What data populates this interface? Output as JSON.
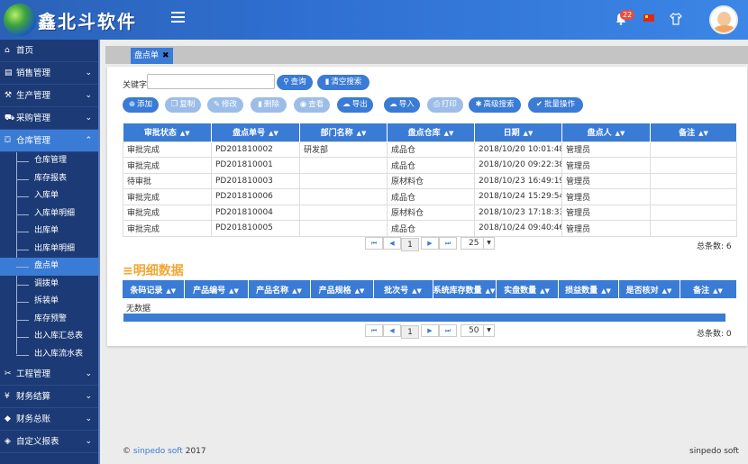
{
  "header": {
    "brand": "鑫北斗软件",
    "notification_count": "22",
    "colors": {
      "accent": "#3a7bd5",
      "sidebar": "#1c3b76",
      "section_title": "#f2a632"
    }
  },
  "sidebar": {
    "items": [
      {
        "label": "首页",
        "icon": "home-icon"
      },
      {
        "label": "销售管理",
        "icon": "list-icon"
      },
      {
        "label": "生产管理",
        "icon": "wrench-icon"
      },
      {
        "label": "采购管理",
        "icon": "cart-icon"
      },
      {
        "label": "仓库管理",
        "icon": "bag-icon"
      }
    ],
    "sub_items": [
      "仓库管理",
      "库存报表",
      "入库单",
      "入库单明细",
      "出库单",
      "出库单明细",
      "盘点单",
      "调拨单",
      "拆装单",
      "库存预警",
      "出入库汇总表",
      "出入库流水表"
    ],
    "bottom_items": [
      {
        "label": "工程管理",
        "icon": "tools-icon"
      },
      {
        "label": "财务结算",
        "icon": "money-icon"
      },
      {
        "label": "财务总账",
        "icon": "ledger-icon"
      },
      {
        "label": "自定义报表",
        "icon": "report-icon"
      }
    ]
  },
  "tabs": [
    {
      "label": "盘点单",
      "close": "✖"
    }
  ],
  "search": {
    "label": "关键字",
    "value": "",
    "query_button": "查询",
    "clear_button": "清空搜索"
  },
  "toolbar": {
    "add": "添加",
    "copy": "复制",
    "edit": "修改",
    "delete": "删除",
    "view": "查看",
    "export": "导出",
    "import": "导入",
    "print": "打印",
    "advanced": "高级搜索",
    "batch": "批量操作"
  },
  "main_table": {
    "headers": [
      "审批状态",
      "盘点单号",
      "部门名称",
      "盘点仓库",
      "日期",
      "盘点人",
      "备注"
    ],
    "rows": [
      [
        "审批完成",
        "PD201810002",
        "研发部",
        "成品仓",
        "2018/10/20 10:01:48",
        "管理员",
        ""
      ],
      [
        "审批完成",
        "PD201810001",
        "",
        "成品仓",
        "2018/10/20 09:22:38",
        "管理员",
        ""
      ],
      [
        "待审批",
        "PD201810003",
        "",
        "原材料仓",
        "2018/10/23 16:49:19",
        "管理员",
        ""
      ],
      [
        "审批完成",
        "PD201810006",
        "",
        "成品仓",
        "2018/10/24 15:29:54",
        "管理员",
        ""
      ],
      [
        "审批完成",
        "PD201810004",
        "",
        "原材料仓",
        "2018/10/23 17:18:33",
        "管理员",
        ""
      ],
      [
        "审批完成",
        "PD201810005",
        "",
        "成品仓",
        "2018/10/24 09:40:46",
        "管理员",
        ""
      ]
    ],
    "page": "1",
    "page_size": "25",
    "total": "总条数: 6"
  },
  "detail": {
    "title": "≡明细数据",
    "headers": [
      "条码记录",
      "产品编号",
      "产品名称",
      "产品规格",
      "批次号",
      "系统库存数量",
      "实盘数量",
      "损益数量",
      "是否核对",
      "备注"
    ],
    "empty": "无数据",
    "page": "1",
    "page_size": "50",
    "total": "总条数: 0"
  },
  "footer": {
    "copyright": "©",
    "brand": "sinpedo soft",
    "year": "2017",
    "right": "sinpedo soft"
  }
}
